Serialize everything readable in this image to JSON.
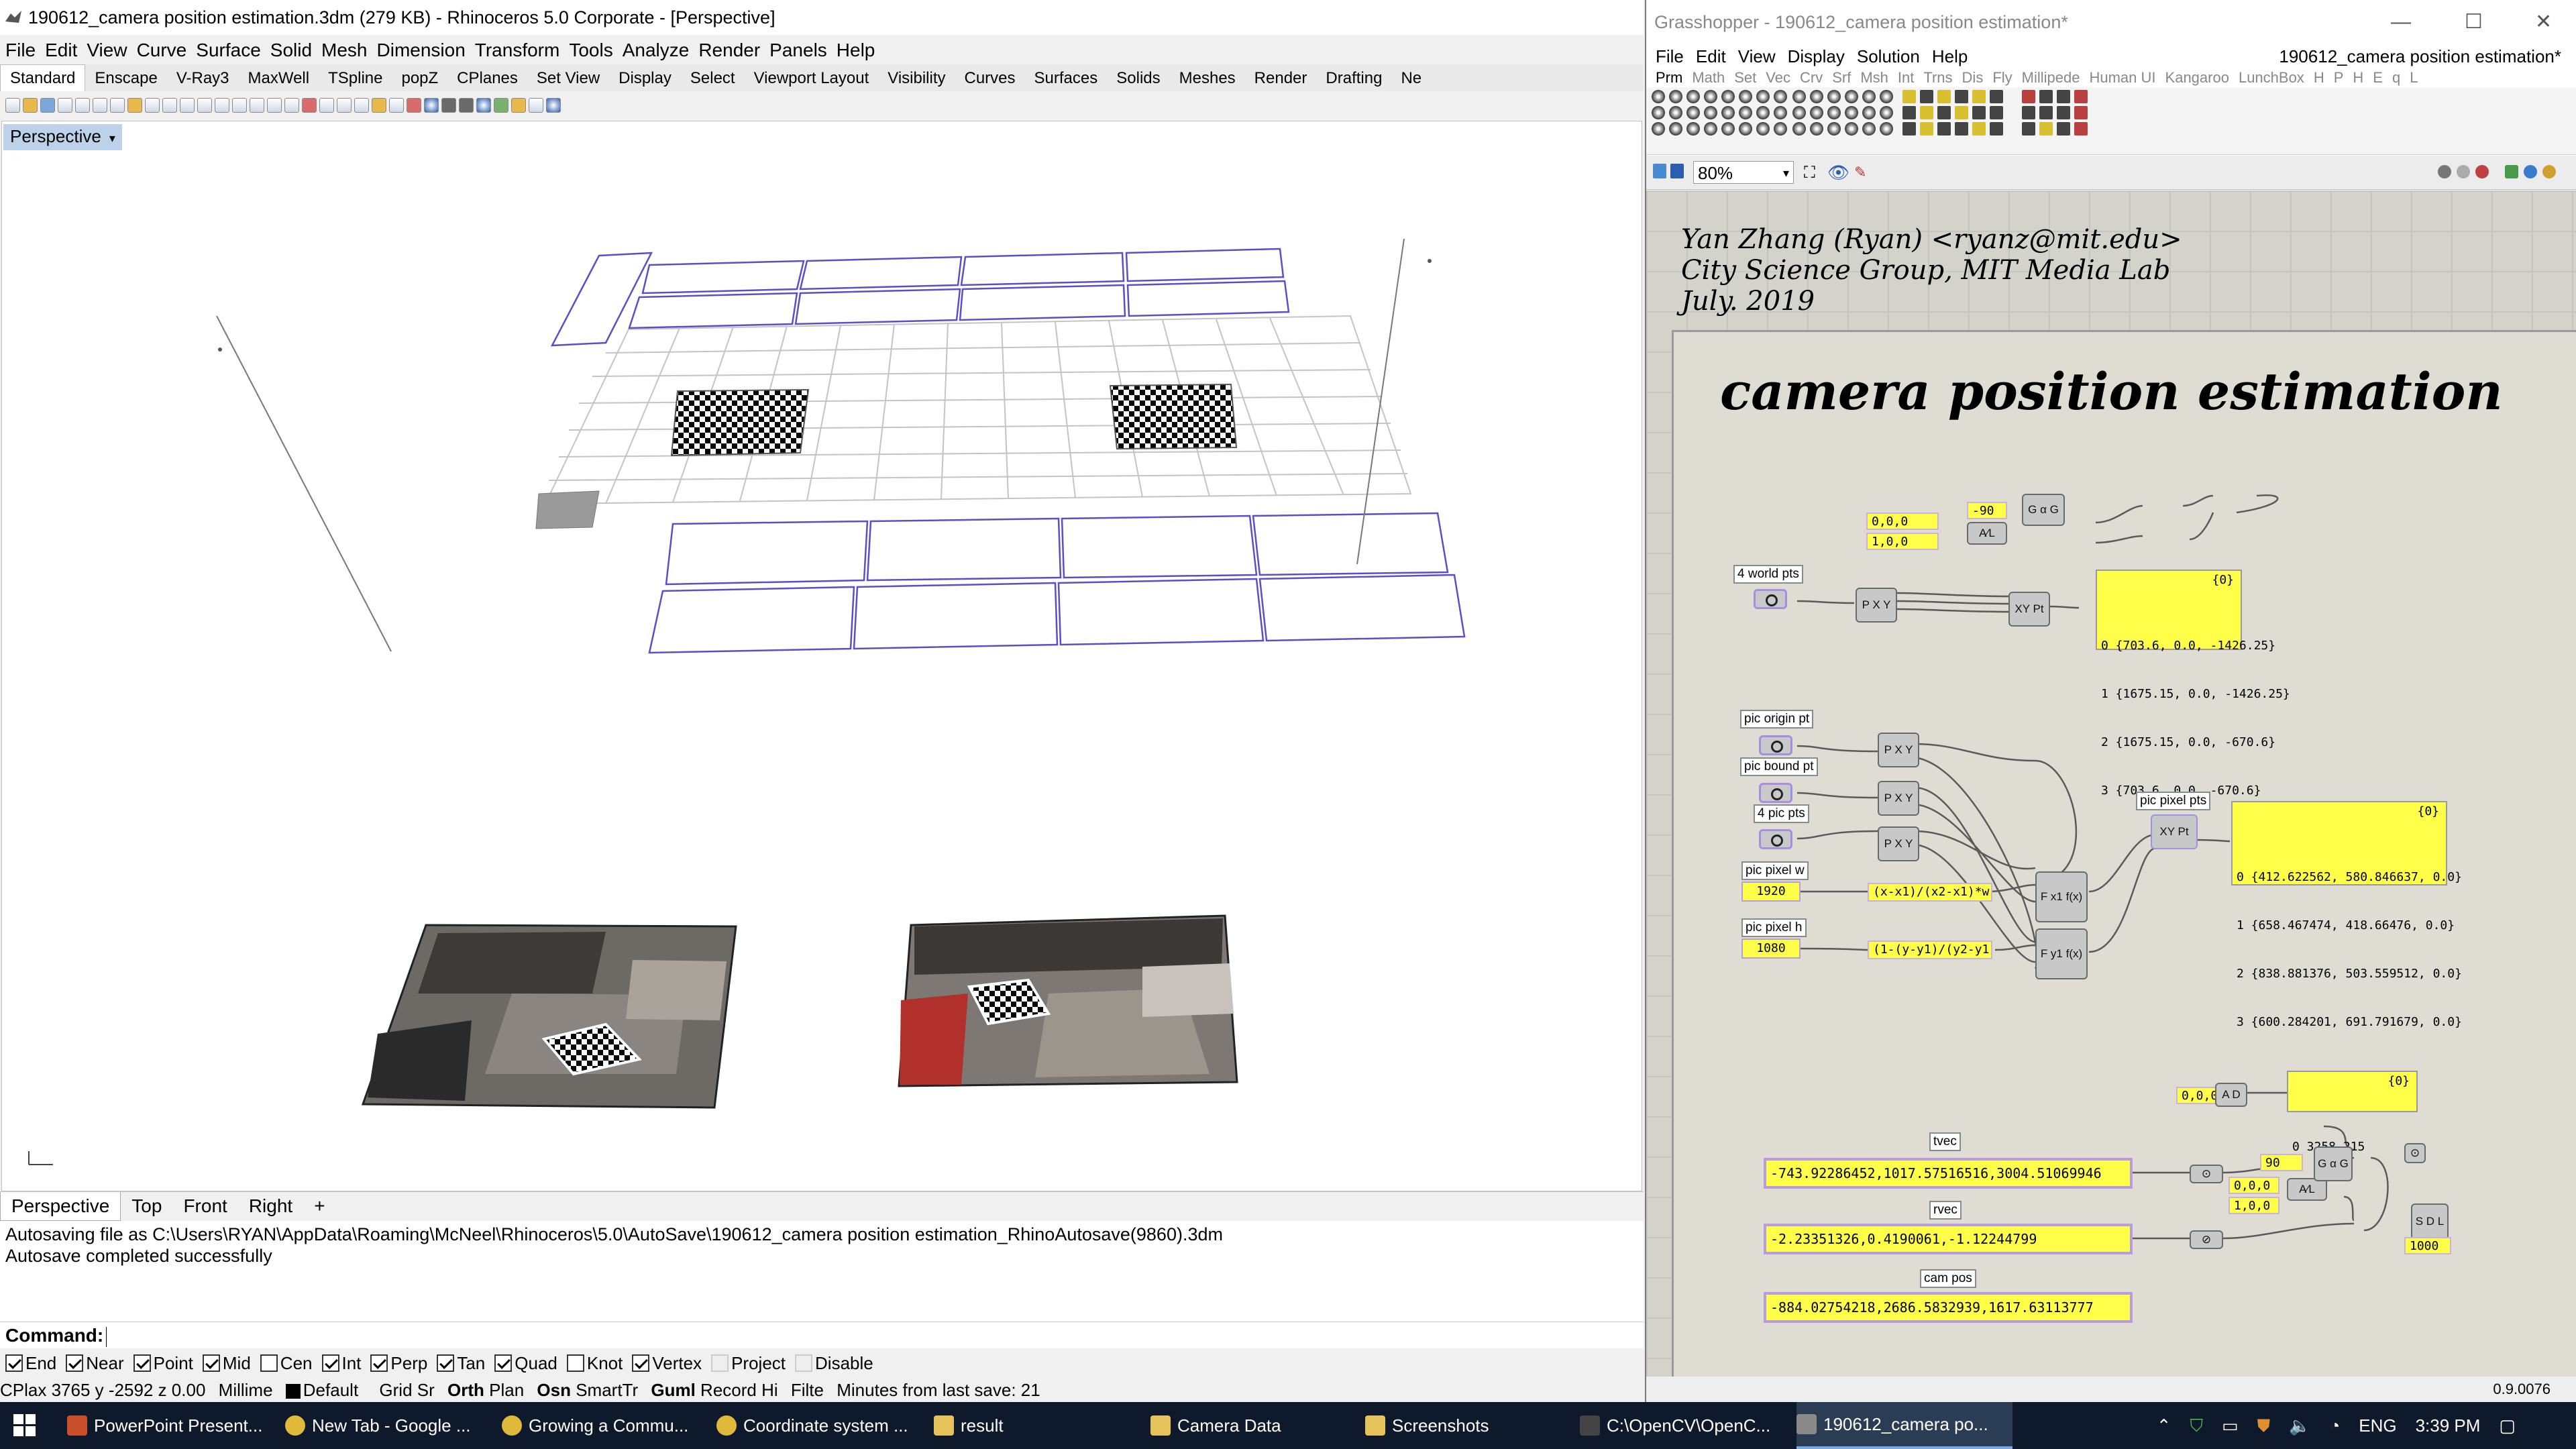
{
  "rhino": {
    "title": "190612_camera position estimation.3dm (279 KB) - Rhinoceros  5.0 Corporate - [Perspective]",
    "menu": [
      "File",
      "Edit",
      "View",
      "Curve",
      "Surface",
      "Solid",
      "Mesh",
      "Dimension",
      "Transform",
      "Tools",
      "Analyze",
      "Render",
      "Panels",
      "Help"
    ],
    "toolbar_tabs": [
      "Standard",
      "Enscape",
      "V-Ray3",
      "MaxWell",
      "TSpline",
      "popZ",
      "CPlanes",
      "Set View",
      "Display",
      "Select",
      "Viewport Layout",
      "Visibility",
      "Curves",
      "Surfaces",
      "Solids",
      "Meshes",
      "Render",
      "Drafting",
      "Ne"
    ],
    "viewport_label": "Perspective",
    "viewport_tabs": [
      "Perspective",
      "Top",
      "Front",
      "Right",
      "+"
    ],
    "history": [
      "Autosaving file as C:\\Users\\RYAN\\AppData\\Roaming\\McNeel\\Rhinoceros\\5.0\\AutoSave\\190612_camera position estimation_RhinoAutosave(9860).3dm",
      "Autosave completed successfully"
    ],
    "command_label": "Command:",
    "osnaps": [
      {
        "label": "End",
        "on": true
      },
      {
        "label": "Near",
        "on": true
      },
      {
        "label": "Point",
        "on": true
      },
      {
        "label": "Mid",
        "on": true
      },
      {
        "label": "Cen",
        "on": false
      },
      {
        "label": "Int",
        "on": true
      },
      {
        "label": "Perp",
        "on": true
      },
      {
        "label": "Tan",
        "on": true
      },
      {
        "label": "Quad",
        "on": true
      },
      {
        "label": "Knot",
        "on": false
      },
      {
        "label": "Vertex",
        "on": true
      },
      {
        "label": "Project",
        "on": false,
        "disabled": true
      },
      {
        "label": "Disable",
        "on": false,
        "disabled": true
      }
    ],
    "status": {
      "cplane": "CPlax 3765 y -2592 z 0.00",
      "units": "Millime",
      "layer": "Default",
      "grid": "Grid Sr",
      "ortho": "Orth",
      "planar": "Plan",
      "osnap": "Osn",
      "smarttrack": "SmartTr",
      "gumball": "Guml",
      "record": "Record Hi",
      "filter": "Filte",
      "save": "Minutes from last save: 21"
    },
    "colors": {
      "viewport_label_bg": "#bcd1ea",
      "curve_blue": "#5a4fc8",
      "checker": "#000000"
    }
  },
  "gh": {
    "title": "Grasshopper - 190612_camera position estimation*",
    "menu": [
      "File",
      "Edit",
      "View",
      "Display",
      "Solution",
      "Help"
    ],
    "doc_name": "190612_camera position estimation*",
    "tabs": [
      "Prm",
      "Math",
      "Set",
      "Vec",
      "Crv",
      "Srf",
      "Msh",
      "Int",
      "Trns",
      "Dis",
      "Fly",
      "Millipede",
      "Human UI",
      "Kangaroo",
      "LunchBox",
      "H",
      "P",
      "H",
      "E",
      "q",
      "L"
    ],
    "zoom": "80%",
    "scribble": [
      "Yan Zhang (Ryan) <ryanz@mit.edu>",
      "City Science Group, MIT Media Lab",
      "July. 2019"
    ],
    "heading": "camera position estimation",
    "labels": {
      "world_pts": "4 world pts",
      "pic_origin": "pic origin pt",
      "pic_bound": "pic bound pt",
      "pic_pts": "4 pic pts",
      "pic_w": "pic pixel w",
      "pic_h": "pic pixel h",
      "pic_pixel_pts": "pic pixel pts",
      "tvec": "tvec",
      "rvec": "rvec",
      "cam_pos": "cam pos"
    },
    "values": {
      "vec_000": "0,0,0",
      "vec_100": "1,0,0",
      "angle": "-90",
      "pic_w": "1920",
      "pic_h": "1080",
      "expr_x": "(x-x1)/(x2-x1)*w",
      "expr_y": "(1-(y-y1)/(y2-y1))*h",
      "origin2": "0,0,0",
      "dist_out": "0 3258.215",
      "vec2_000": "0,0,0",
      "vec2_100": "1,0,0",
      "neg_90": "90",
      "len": "1000",
      "tvec": "-743.92286452,1017.57516516,3004.51069946",
      "rvec": "-2.23351326,0.4190061,-1.12244799",
      "cam_pos": "-884.02754218,2686.5832939,1617.63113777"
    },
    "panel_header": "{0}",
    "world_pts_out": [
      "0 {703.6, 0.0, -1426.25}",
      "1 {1675.15, 0.0, -1426.25}",
      "2 {1675.15, 0.0, -670.6}",
      "3 {703.6, 0.0, -670.6}"
    ],
    "pixel_pts_out": [
      "0 {412.622562, 580.846637, 0.0}",
      "1 {658.467474, 418.66476, 0.0}",
      "2 {838.881376, 503.559512, 0.0}",
      "3 {600.284201, 691.791679, 0.0}"
    ],
    "dist_header": "{0}",
    "status_version": "0.9.0076",
    "colors": {
      "canvas": "#d4d3cb",
      "panel_yellow": "#ffff4a",
      "wire": "#5a5a5a"
    }
  },
  "taskbar": {
    "items": [
      {
        "label": "PowerPoint Present...",
        "icon": "powerpoint-icon",
        "color": "#c94f2b"
      },
      {
        "label": "New Tab - Google ...",
        "icon": "chrome-icon",
        "color": "#e0b93b"
      },
      {
        "label": "Growing a Commu...",
        "icon": "chrome-icon",
        "color": "#e0b93b"
      },
      {
        "label": "Coordinate system ...",
        "icon": "chrome-icon",
        "color": "#e0b93b"
      },
      {
        "label": "result",
        "icon": "folder-icon",
        "color": "#e6c25a"
      },
      {
        "label": "Camera Data",
        "icon": "folder-icon",
        "color": "#e6c25a"
      },
      {
        "label": "Screenshots",
        "icon": "folder-icon",
        "color": "#e6c25a"
      },
      {
        "label": "C:\\OpenCV\\OpenC...",
        "icon": "terminal-icon",
        "color": "#444444"
      },
      {
        "label": "190612_camera po...",
        "icon": "rhino-icon",
        "color": "#8a8a8a"
      }
    ],
    "lang": "ENG",
    "time": "3:39 PM"
  }
}
